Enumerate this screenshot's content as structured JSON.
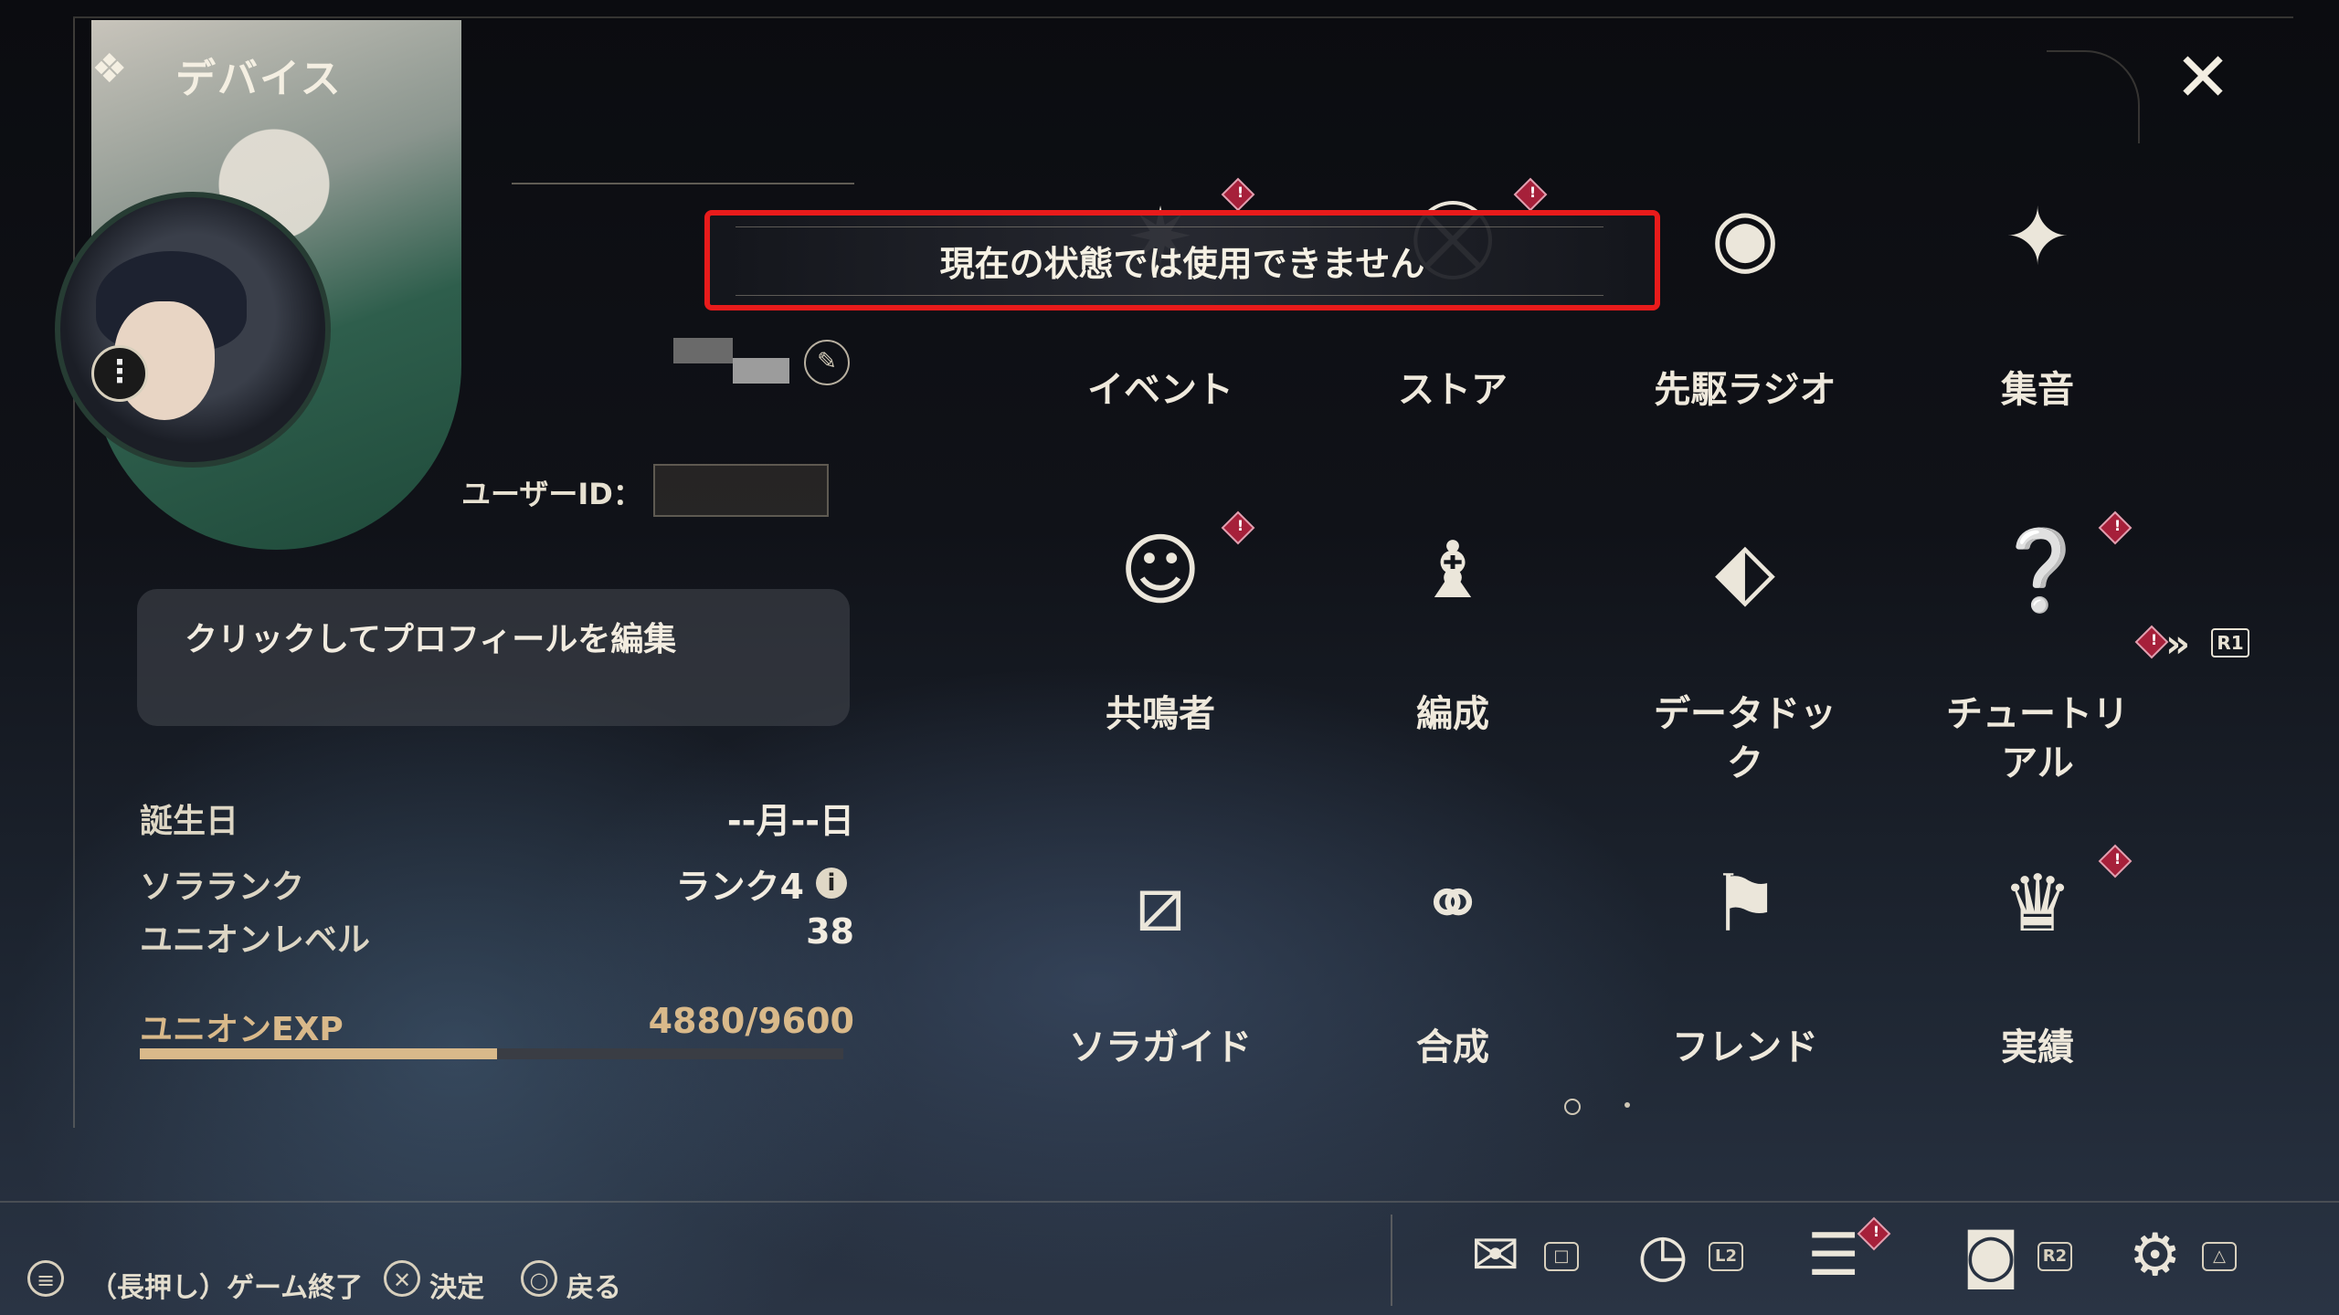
{
  "header": {
    "title": "デバイス",
    "close_icon": "close-icon"
  },
  "profile": {
    "user_id_label": "ユーザーID：",
    "edit_profile_label": "クリックしてプロフィールを編集",
    "stats": [
      {
        "label": "誕生日",
        "value": "--月--日"
      },
      {
        "label": "ソラランク",
        "value": "ランク4"
      },
      {
        "label": "ユニオンレベル",
        "value": "38"
      }
    ],
    "exp": {
      "label": "ユニオンEXP",
      "value": "4880/9600",
      "progress": 0.508
    }
  },
  "toast": {
    "message": "現在の状態では使用できません"
  },
  "menu": {
    "items": [
      {
        "label": "イベント",
        "icon": "event-icon",
        "alert": true
      },
      {
        "label": "ストア",
        "icon": "store-icon",
        "alert": true
      },
      {
        "label": "先駆ラジオ",
        "icon": "radio-icon",
        "alert": false
      },
      {
        "label": "集音",
        "icon": "sound-collect-icon",
        "alert": false
      },
      {
        "label": "共鳴者",
        "icon": "resonator-icon",
        "alert": true
      },
      {
        "label": "編成",
        "icon": "team-icon",
        "alert": false
      },
      {
        "label": "データドック",
        "icon": "data-dock-icon",
        "alert": false
      },
      {
        "label": "チュートリアル",
        "icon": "tutorial-icon",
        "alert": true
      },
      {
        "label": "ソラガイド",
        "icon": "guide-icon",
        "alert": false
      },
      {
        "label": "合成",
        "icon": "synthesis-icon",
        "alert": false
      },
      {
        "label": "フレンド",
        "icon": "friend-icon",
        "alert": false
      },
      {
        "label": "実績",
        "icon": "achievement-icon",
        "alert": true
      }
    ],
    "next_page_badge": "R1"
  },
  "footer": {
    "hints": [
      {
        "icon": "options-button-icon",
        "label": "（長押し）ゲーム終了"
      },
      {
        "icon": "cross-button-icon",
        "label": "決定"
      },
      {
        "icon": "circle-button-icon",
        "label": "戻る"
      }
    ],
    "quick_buttons": [
      {
        "icon": "mail-icon",
        "badge": "□"
      },
      {
        "icon": "clock-icon",
        "badge": "L2"
      },
      {
        "icon": "notice-icon",
        "badge": ""
      },
      {
        "icon": "camera-icon",
        "badge": "R2"
      },
      {
        "icon": "gear-icon",
        "badge": "△"
      }
    ]
  }
}
